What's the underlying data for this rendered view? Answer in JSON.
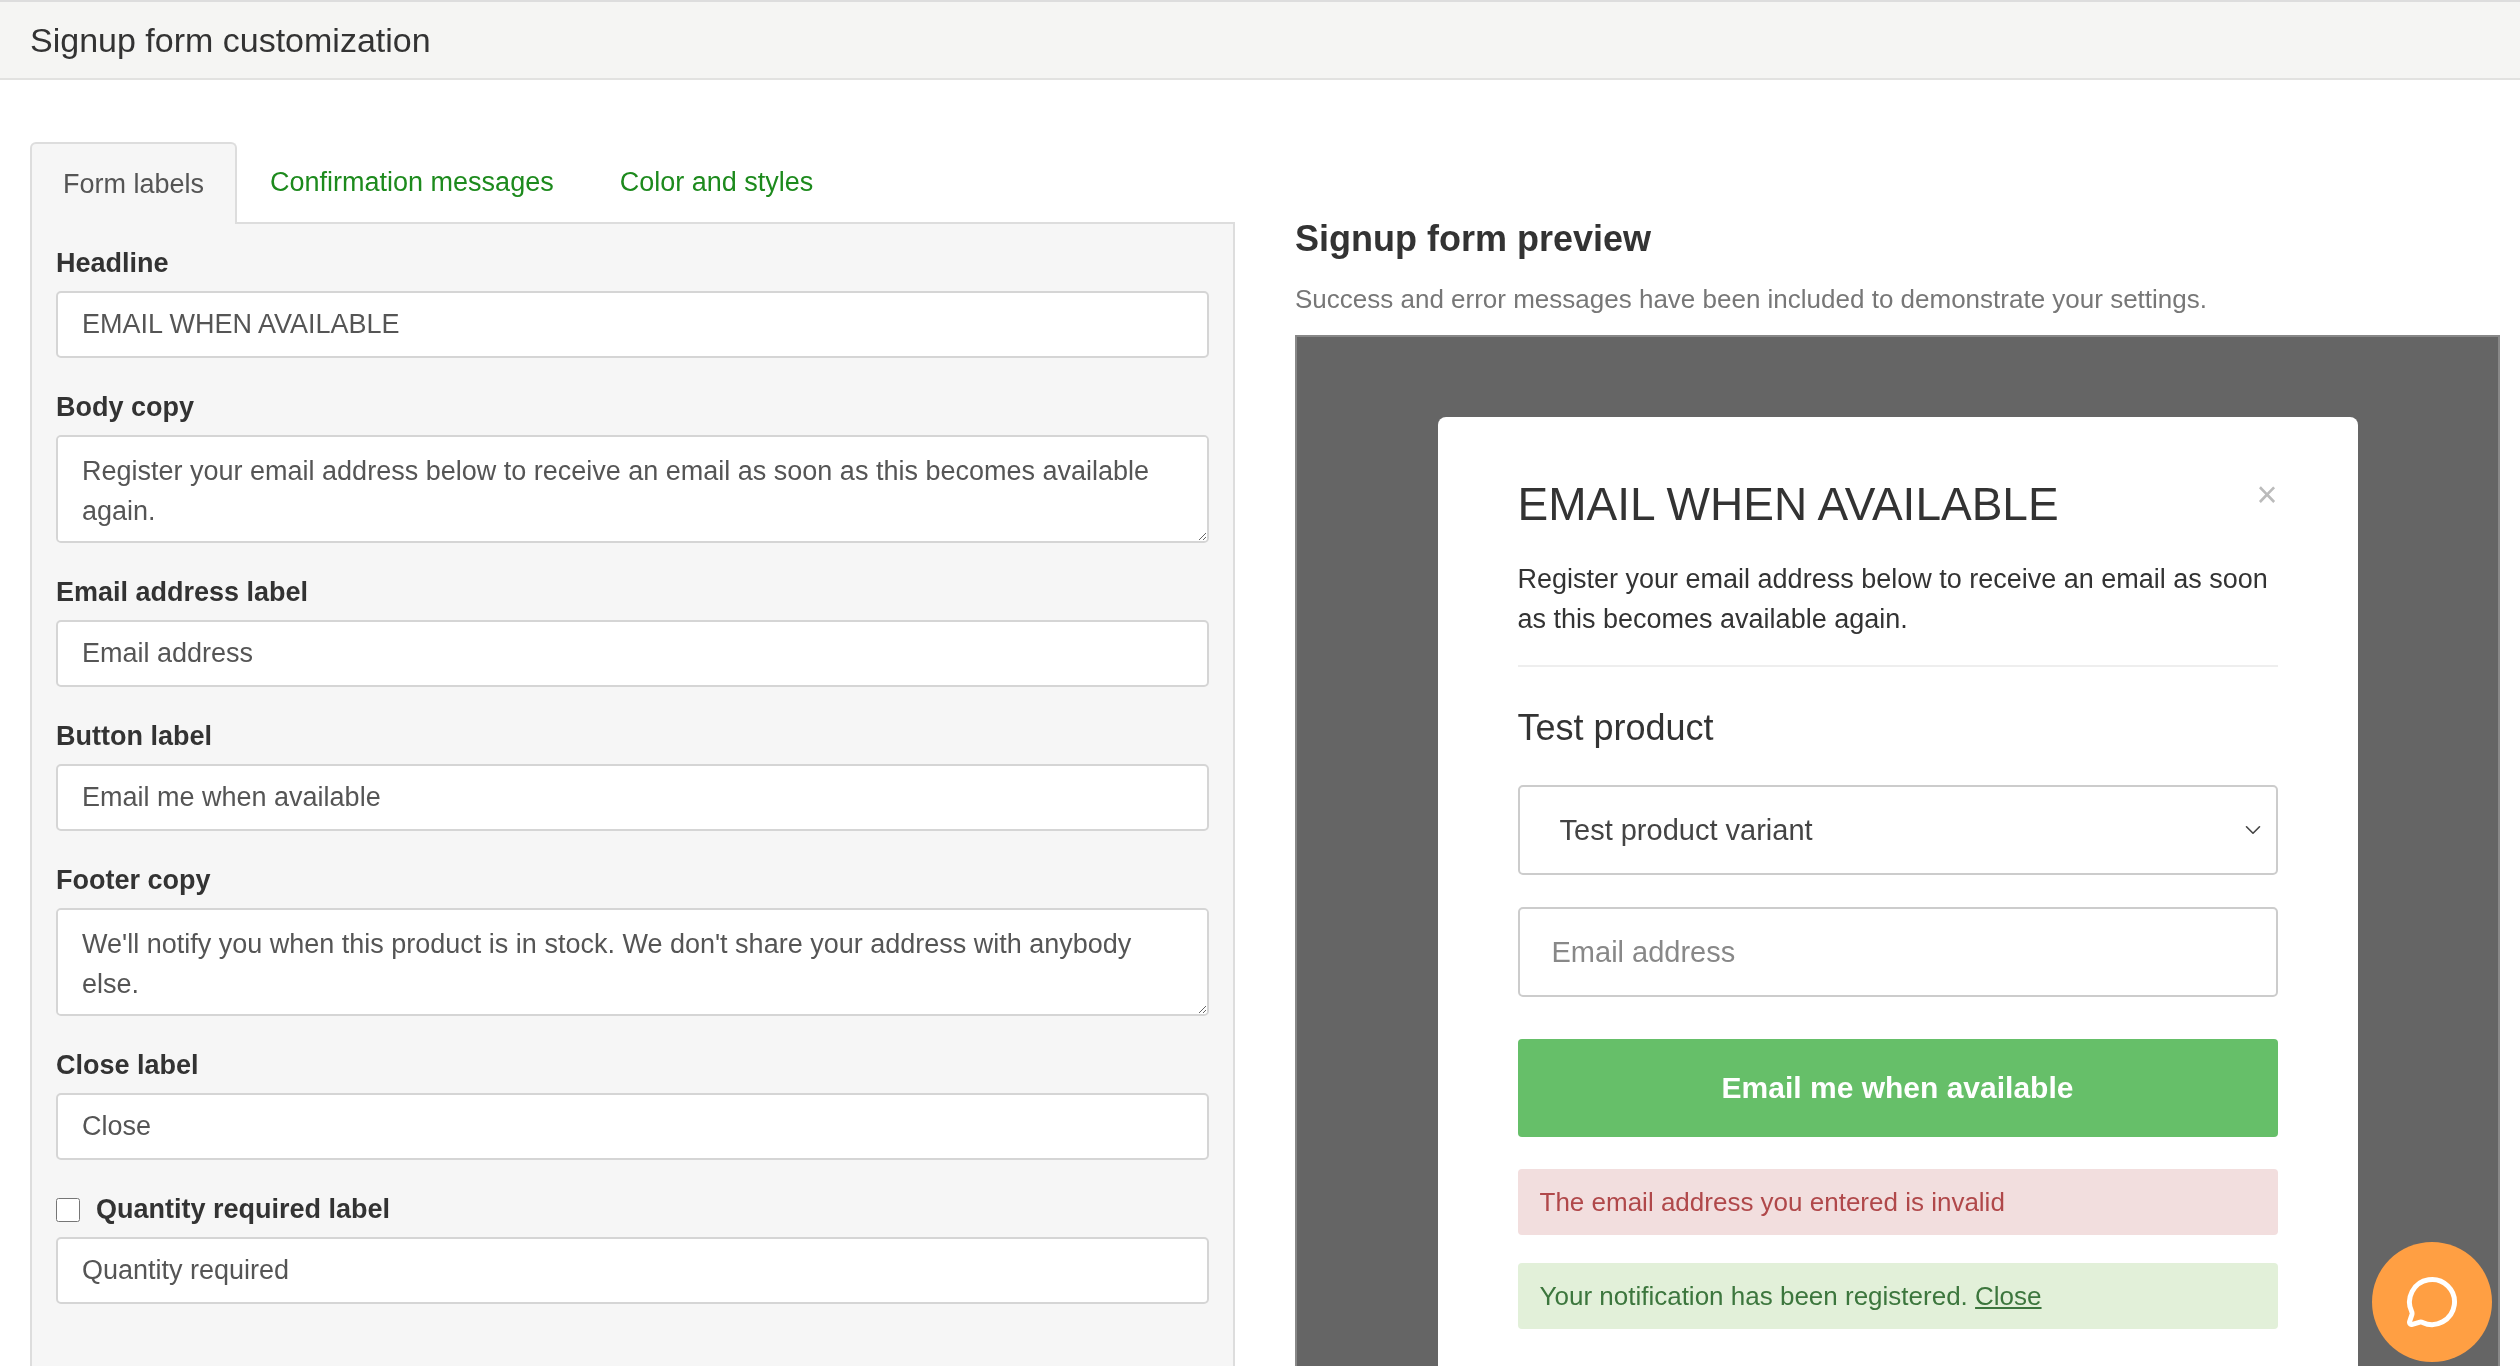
{
  "header": {
    "title": "Signup form customization"
  },
  "tabs": [
    {
      "label": "Form labels",
      "selected": true
    },
    {
      "label": "Confirmation messages",
      "selected": false
    },
    {
      "label": "Color and styles",
      "selected": false
    }
  ],
  "fields": [
    {
      "kind": "input",
      "label": "Headline",
      "value": "EMAIL WHEN AVAILABLE"
    },
    {
      "kind": "textarea",
      "label": "Body copy",
      "value": "Register your email address below to receive an email as soon as this becomes available again."
    },
    {
      "kind": "input",
      "label": "Email address label",
      "value": "Email address"
    },
    {
      "kind": "input",
      "label": "Button label",
      "value": "Email me when available"
    },
    {
      "kind": "textarea",
      "label": "Footer copy",
      "value": "We'll notify you when this product is in stock. We don't share your address with anybody else."
    },
    {
      "kind": "input",
      "label": "Close label",
      "value": "Close"
    },
    {
      "kind": "checkbox",
      "label": "Quantity required label",
      "checked": false,
      "value": "Quantity required"
    }
  ],
  "preview": {
    "title": "Signup form preview",
    "subtitle": "Success and error messages have been included to demonstrate your settings.",
    "modal": {
      "headline": "EMAIL WHEN AVAILABLE",
      "close": "×",
      "body": "Register your email address below to receive an email as soon as this becomes available again.",
      "product": "Test product",
      "variant": "Test product variant",
      "email_placeholder": "Email address",
      "button": "Email me when available",
      "error": "The email address you entered is invalid",
      "success": {
        "text": "Your notification has been registered.",
        "link": "Close"
      }
    }
  }
}
